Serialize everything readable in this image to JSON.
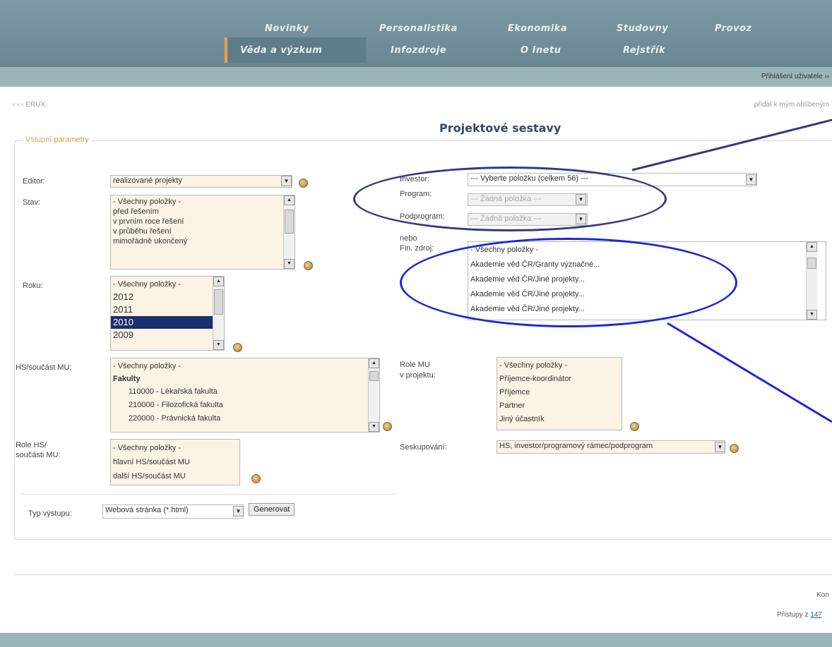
{
  "nav": {
    "row1": [
      "Novinky",
      "Personalistika",
      "Ekonomika",
      "Studovny",
      "Provoz"
    ],
    "row2": [
      "Věda a výzkum",
      "Infozdroje",
      "O Inetu",
      "Rejstřík"
    ]
  },
  "header": {
    "login_link": "Přihlášení uživatele ››"
  },
  "breadcrumb": {
    "left": "‹ ‹ ‹ ERUX",
    "right": "přidat k mým oblíbeným"
  },
  "page_title": "Projektové sestavy",
  "form": {
    "legend": "Vstupní parametry",
    "editor": {
      "label": "Editor:",
      "value": "realizované projekty"
    },
    "stav": {
      "label": "Stav:",
      "options": [
        "- Všechny položky -",
        "před řešením",
        "v prvním roce řešení",
        "v průběhu řešení",
        "mimořádně ukončený"
      ]
    },
    "roku": {
      "label": "Roku:",
      "options": [
        "- Všechny položky -",
        "2012",
        "2011",
        "2010",
        "2009"
      ],
      "selected_index": 3
    },
    "hs": {
      "label": "HS/součást MU:",
      "options": [
        "- Všechny položky -",
        "Fakulty",
        "110000 - Lékařská fakulta",
        "210000 - Filozofická fakulta",
        "220000 - Právnická fakulta"
      ]
    },
    "role_hs": {
      "label1": "Role HS/",
      "label2": "součásti MU:",
      "options": [
        "- Všechny položky -",
        "hlavní HS/součást MU",
        "další HS/součást MU"
      ]
    },
    "investor": {
      "label": "Investor:",
      "value": "--- Vyberte položku (celkem 56) ---"
    },
    "program": {
      "label": "Program:",
      "value": "--- Žádná položka ---"
    },
    "podprogram": {
      "label": "Podprogram:",
      "value": "--- Žádná položka ---"
    },
    "nebo": "nebo",
    "fin_zdroj": {
      "label": "Fin. zdroj:",
      "options": [
        "- Všechny položky -",
        "Akademie věd ČR/Granty význačné...",
        "Akademie věd ČR/Jiné projekty...",
        "Akademie věd ČR/Jiné projekty...",
        "Akademie věd ČR/Jiné projekty..."
      ]
    },
    "role_mu": {
      "label1": "Role MU",
      "label2": "v projektu:",
      "options": [
        "- Všechny položky -",
        "Příjemce-koordinátor",
        "Příjemce",
        "Partner",
        "Jiný účastník"
      ]
    },
    "seskupovani": {
      "label": "Seskupování:",
      "value": "HS, investor/programový rámec/podprogram"
    },
    "typ_vystupu": {
      "label": "Typ výstupu:",
      "value": "Webová stránka (*.html)"
    },
    "generate_label": "Generovat"
  },
  "footer": {
    "right_text": "Kon",
    "visits_label": "Přístupy z",
    "visits_value": "147"
  },
  "colors": {
    "topbar": "#6a8791",
    "subbar": "#9bb5bc",
    "title": "#2d4b6a",
    "annotation": "#3a3ab3",
    "selected_option": "#1c2f6e"
  }
}
